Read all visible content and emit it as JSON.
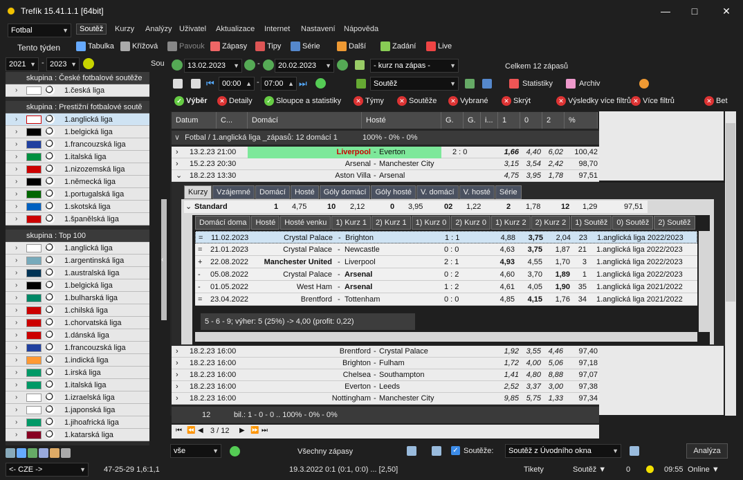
{
  "window": {
    "title": "Trefík 15.41.1.1 [64bit]"
  },
  "menu": {
    "sport": "Fotbal",
    "items": [
      "Soutěž",
      "Kurzy",
      "Analýzy",
      "Uživatel",
      "Aktualizace",
      "Internet",
      "Nastavení",
      "Nápověda"
    ],
    "period": "Tento týden"
  },
  "toolbar1": [
    "Tabulka",
    "Křížová",
    "Pavouk",
    "Zápasy",
    "Tipy",
    "Série",
    "Další",
    "Zadání",
    "Live"
  ],
  "years": {
    "from": "2021",
    "to": "2023",
    "sou": "Sou"
  },
  "dates": {
    "from": "13.02.2023",
    "to": "20.02.2023",
    "odds_filter": "- kurz na zápas -",
    "total": "Celkem 12 zápasů",
    "time_from": "00:00",
    "time_to": "07:00",
    "competition": "Soutěž",
    "stats": "Statistiky",
    "archive": "Archiv"
  },
  "filters": [
    "Výběr",
    "Detaily",
    "Sloupce a statistiky",
    "Týmy",
    "Soutěže",
    "Vybrané",
    "Skrýt",
    "Výsledky více filtrů",
    "Více filtrů",
    "Bet"
  ],
  "left": {
    "group1": "skupina : České fotbalové soutěže",
    "group1_items": [
      "1.česká liga"
    ],
    "group2": "skupina : Prestižní fotbalové soutě",
    "group2_items": [
      "1.anglická liga",
      "1.belgická liga",
      "1.francouzská liga",
      "1.italská liga",
      "1.nizozemská liga",
      "1.německá liga",
      "1.portugalská liga",
      "1.skotská liga",
      "1.španělská liga"
    ],
    "group3": "skupina : Top 100",
    "group3_items": [
      "1.anglická liga",
      "1.argentinská liga",
      "1.australská liga",
      "1.belgická liga",
      "1.bulharská liga",
      "1.chilská liga",
      "1.chorvatská liga",
      "1.dánská liga",
      "1.francouzská liga",
      "1.indická liga",
      "1.irská liga",
      "1.italská liga",
      "1.izraelská liga",
      "1.japonská liga",
      "1.jihoafrická liga",
      "1.katarská liga"
    ]
  },
  "grid": {
    "headers": [
      "Datum",
      "C...",
      "Domácí",
      "Hosté",
      "G.",
      "G.",
      "i...",
      "1",
      "0",
      "2",
      "%"
    ],
    "group_row": "Fotbal / 1.anglická liga _zápasů: 12  domácí 1",
    "group_pct": "100% - 0% - 0%",
    "rows_top": [
      {
        "d": "13.2.23 21:00",
        "home": "Liverpool",
        "away": "Everton",
        "score": "2 : 0",
        "o1": "1,66",
        "o0": "4,40",
        "o2": "6,02",
        "pct": "100,42"
      },
      {
        "d": "15.2.23 20:30",
        "home": "Arsenal",
        "away": "Manchester City",
        "score": "",
        "o1": "3,15",
        "o0": "3,54",
        "o2": "2,42",
        "pct": "98,70"
      },
      {
        "d": "18.2.23 13:30",
        "home": "Aston Villa",
        "away": "Arsenal",
        "score": "",
        "o1": "4,75",
        "o0": "3,95",
        "o2": "1,78",
        "pct": "97,51"
      }
    ],
    "detail_tabs": [
      "Kurzy",
      "Vzájemné",
      "Domácí",
      "Hosté",
      "Góly domácí",
      "Góly hosté",
      "V. domácí",
      "V. hosté",
      "Série"
    ],
    "standard": {
      "label": "Standard",
      "c1": "1",
      "v1": "4,75",
      "c2": "10",
      "v2": "2,12",
      "c3": "0",
      "v3": "3,95",
      "c4": "02",
      "v4": "1,22",
      "c5": "2",
      "v5": "1,78",
      "c6": "12",
      "v6": "1,29",
      "pct": "97,51"
    },
    "sub_tabs": [
      "Domácí doma",
      "Hosté",
      "Hosté venku",
      "1) Kurz 1",
      "2) Kurz 1",
      "1) Kurz 0",
      "2) Kurz 0",
      "1) Kurz 2",
      "2) Kurz 2",
      "1) Soutěž",
      "0) Soutěž",
      "2) Soutěž"
    ],
    "sub_rows": [
      {
        "m": "=",
        "d": "11.02.2023",
        "h": "Crystal Palace",
        "a": "Brighton",
        "s": "1 : 1",
        "o1": "4,88",
        "o0": "3,75",
        "o2": "2,04",
        "n": "23",
        "l": "1.anglická liga 2022/2023"
      },
      {
        "m": "=",
        "d": "21.01.2023",
        "h": "Crystal Palace",
        "a": "Newcastle",
        "s": "0 : 0",
        "o1": "4,63",
        "o0": "3,75",
        "o2": "1,87",
        "n": "21",
        "l": "1.anglická liga 2022/2023"
      },
      {
        "m": "+",
        "d": "22.08.2022",
        "h": "Manchester United",
        "a": "Liverpool",
        "s": "2 : 1",
        "o1": "4,93",
        "o0": "4,55",
        "o2": "1,70",
        "n": "3",
        "l": "1.anglická liga 2022/2023"
      },
      {
        "m": "-",
        "d": "05.08.2022",
        "h": "Crystal Palace",
        "a": "Arsenal",
        "s": "0 : 2",
        "o1": "4,60",
        "o0": "3,70",
        "o2": "1,89",
        "n": "1",
        "l": "1.anglická liga 2022/2023"
      },
      {
        "m": "-",
        "d": "01.05.2022",
        "h": "West Ham",
        "a": "Arsenal",
        "s": "1 : 2",
        "o1": "4,61",
        "o0": "4,05",
        "o2": "1,90",
        "n": "35",
        "l": "1.anglická liga 2021/2022"
      },
      {
        "m": "=",
        "d": "23.04.2022",
        "h": "Brentford",
        "a": "Tottenham",
        "s": "0 : 0",
        "o1": "4,85",
        "o0": "4,15",
        "o2": "1,76",
        "n": "34",
        "l": "1.anglická liga 2021/2022"
      }
    ],
    "summary": "5 - 6 - 9;    výher: 5 (25%) -> 4,00 (profit: 0,22)",
    "rows_bottom": [
      {
        "d": "18.2.23 16:00",
        "home": "Brentford",
        "away": "Crystal Palace",
        "o1": "1,92",
        "o0": "3,55",
        "o2": "4,46",
        "pct": "97,40"
      },
      {
        "d": "18.2.23 16:00",
        "home": "Brighton",
        "away": "Fulham",
        "o1": "1,72",
        "o0": "4,00",
        "o2": "5,06",
        "pct": "97,18"
      },
      {
        "d": "18.2.23 16:00",
        "home": "Chelsea",
        "away": "Southampton",
        "o1": "1,41",
        "o0": "4,80",
        "o2": "8,88",
        "pct": "97,07"
      },
      {
        "d": "18.2.23 16:00",
        "home": "Everton",
        "away": "Leeds",
        "o1": "2,52",
        "o0": "3,37",
        "o2": "3,00",
        "pct": "97,38"
      },
      {
        "d": "18.2.23 16:00",
        "home": "Nottingham",
        "away": "Manchester City",
        "o1": "9,85",
        "o0": "5,75",
        "o2": "1,33",
        "pct": "97,34"
      }
    ],
    "footer_count": "12",
    "footer_stats": "bil.: 1 - 0 - 0 .. 100% - 0% - 0%",
    "pager": "3 / 12"
  },
  "bottom": {
    "all": "vše",
    "all_matches": "Všechny zápasy",
    "competitions_label": "Soutěže:",
    "competitions_val": "Soutěž z Úvodního okna",
    "analyze": "Analýza"
  },
  "status": {
    "lang": "<- CZE ->",
    "score": "47-25-29  1,6:1,1",
    "info": "19.3.2022 0:1 (0:1, 0:0) ... [2,50]",
    "tickets": "Tikety",
    "comp": "Soutěž",
    "num": "0",
    "time": "09:55",
    "online": "Online"
  },
  "colors": {
    "accent": "#f2c200",
    "selected": "#cfe3f3",
    "winner": "#7de89a"
  }
}
